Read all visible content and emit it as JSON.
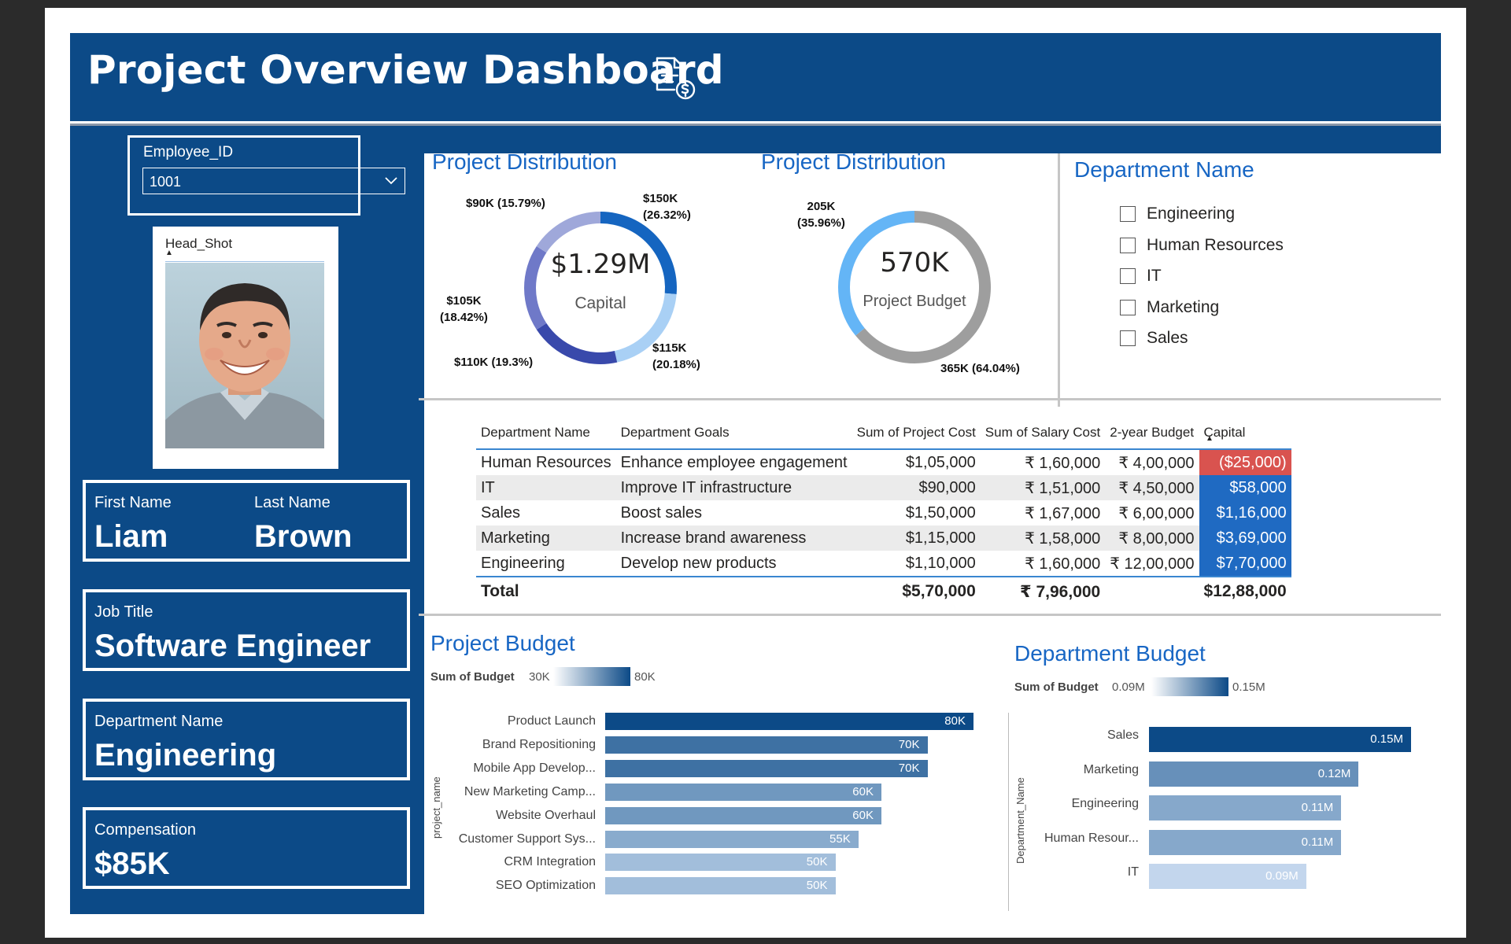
{
  "header": {
    "title": "Project Overview Dashboard",
    "icon": "document-dollar-icon"
  },
  "employee_slicer": {
    "label": "Employee_ID",
    "selected": "1001"
  },
  "headshot": {
    "label": "Head_Shot"
  },
  "profile": {
    "first_name_label": "First Name",
    "first_name": "Liam",
    "last_name_label": "Last Name",
    "last_name": "Brown",
    "job_title_label": "Job Title",
    "job_title": "Software Engineer",
    "department_label": "Department Name",
    "department": "Engineering",
    "compensation_label": "Compensation",
    "compensation": "$85K"
  },
  "donut_capital": {
    "title": "Project Distribution",
    "center_value": "$1.29M",
    "center_label": "Capital",
    "slices": [
      {
        "label": "$150K (26.32%)",
        "value": 150,
        "color": "#1565c0"
      },
      {
        "label": "$115K (20.18%)",
        "value": 115,
        "color": "#a9d0f5"
      },
      {
        "label": "$110K (19.3%)",
        "value": 110,
        "color": "#3949ab"
      },
      {
        "label": "$105K (18.42%)",
        "value": 105,
        "color": "#6f79c8"
      },
      {
        "label": "$90K (15.79%)",
        "value": 90,
        "color": "#9fa8da"
      }
    ],
    "labels": {
      "l150a": "$150K",
      "l150b": "(26.32%)",
      "l115a": "$115K",
      "l115b": "(20.18%)",
      "l110": "$110K (19.3%)",
      "l105a": "$105K",
      "l105b": "(18.42%)",
      "l90": "$90K (15.79%)"
    }
  },
  "donut_budget": {
    "title": "Project Distribution",
    "center_value": "570K",
    "center_label": "Project Budget",
    "slices": [
      {
        "label": "365K (64.04%)",
        "value": 365,
        "color": "#9e9e9e"
      },
      {
        "label": "205K (35.96%)",
        "value": 205,
        "color": "#64b5f6"
      }
    ],
    "labels": {
      "l205a": "205K",
      "l205b": "(35.96%)",
      "l365": "365K (64.04%)"
    }
  },
  "department_slicer": {
    "title": "Department Name",
    "items": [
      "Engineering",
      "Human Resources",
      "IT",
      "Marketing",
      "Sales"
    ]
  },
  "table": {
    "headers": [
      "Department Name",
      "Department Goals",
      "Sum of Project Cost",
      "Sum of Salary Cost",
      "2-year Budget",
      "Capital"
    ],
    "rows": [
      [
        "Human Resources",
        "Enhance employee engagement",
        "$1,05,000",
        "₹ 1,60,000",
        "₹ 4,00,000",
        "($25,000)"
      ],
      [
        "IT",
        "Improve IT infrastructure",
        "$90,000",
        "₹ 1,51,000",
        "₹ 4,50,000",
        "$58,000"
      ],
      [
        "Sales",
        "Boost sales",
        "$1,50,000",
        "₹ 1,67,000",
        "₹ 6,00,000",
        "$1,16,000"
      ],
      [
        "Marketing",
        "Increase brand awareness",
        "$1,15,000",
        "₹ 1,58,000",
        "₹ 8,00,000",
        "$3,69,000"
      ],
      [
        "Engineering",
        "Develop new products",
        "$1,10,000",
        "₹ 1,60,000",
        "₹ 12,00,000",
        "$7,70,000"
      ]
    ],
    "total": [
      "Total",
      "",
      "$5,70,000",
      "₹ 7,96,000",
      "",
      "$12,88,000"
    ],
    "capital_negative_color": "#d9534f",
    "capital_positive_color": "#1f6ac2"
  },
  "project_budget_chart": {
    "title": "Project Budget",
    "legend_title": "Sum of Budget",
    "legend_min": "30K",
    "legend_max": "80K",
    "axis_title": "project_name"
  },
  "department_budget_chart": {
    "title": "Department Budget",
    "legend_title": "Sum of Budget",
    "legend_min": "0.09M",
    "legend_max": "0.15M",
    "axis_title": "Department_Name"
  },
  "chart_data": [
    {
      "type": "bar",
      "title": "Project Budget",
      "orientation": "horizontal",
      "categories": [
        "Product Launch",
        "Brand Repositioning",
        "Mobile App Develop...",
        "New Marketing Camp...",
        "Website Overhaul",
        "Customer Support Sys...",
        "CRM Integration",
        "SEO Optimization"
      ],
      "values": [
        80,
        70,
        70,
        60,
        60,
        55,
        50,
        50
      ],
      "value_labels": [
        "80K",
        "70K",
        "70K",
        "60K",
        "60K",
        "55K",
        "50K",
        "50K"
      ],
      "ylabel": "project_name",
      "xlim": [
        0,
        80
      ]
    },
    {
      "type": "bar",
      "title": "Department Budget",
      "orientation": "horizontal",
      "categories": [
        "Sales",
        "Marketing",
        "Engineering",
        "Human Resour...",
        "IT"
      ],
      "values": [
        0.15,
        0.12,
        0.11,
        0.11,
        0.09
      ],
      "value_labels": [
        "0.15M",
        "0.12M",
        "0.11M",
        "0.11M",
        "0.09M"
      ],
      "ylabel": "Department_Name",
      "xlim": [
        0,
        0.15
      ]
    }
  ]
}
